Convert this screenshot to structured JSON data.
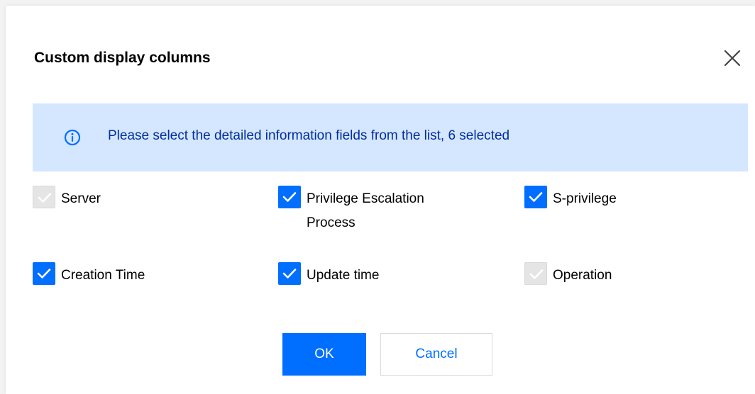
{
  "dialog": {
    "title": "Custom display columns",
    "close_icon": "close-icon"
  },
  "notice": {
    "icon": "info-icon",
    "text": "Please select the detailed information fields from the list, 6 selected"
  },
  "fields": [
    {
      "label": "Server",
      "checked": true,
      "disabled": true
    },
    {
      "label": "Privilege Escalation Process",
      "checked": true,
      "disabled": false
    },
    {
      "label": "S-privilege",
      "checked": true,
      "disabled": false
    },
    {
      "label": "Creation Time",
      "checked": true,
      "disabled": false
    },
    {
      "label": "Update time",
      "checked": true,
      "disabled": false
    },
    {
      "label": "Operation",
      "checked": true,
      "disabled": true
    }
  ],
  "footer": {
    "ok_label": "OK",
    "cancel_label": "Cancel"
  },
  "colors": {
    "primary": "#006eff",
    "notice_bg": "#d5e7ff",
    "notice_text": "#002da0",
    "disabled_checkbox": "#e5e5e5"
  }
}
